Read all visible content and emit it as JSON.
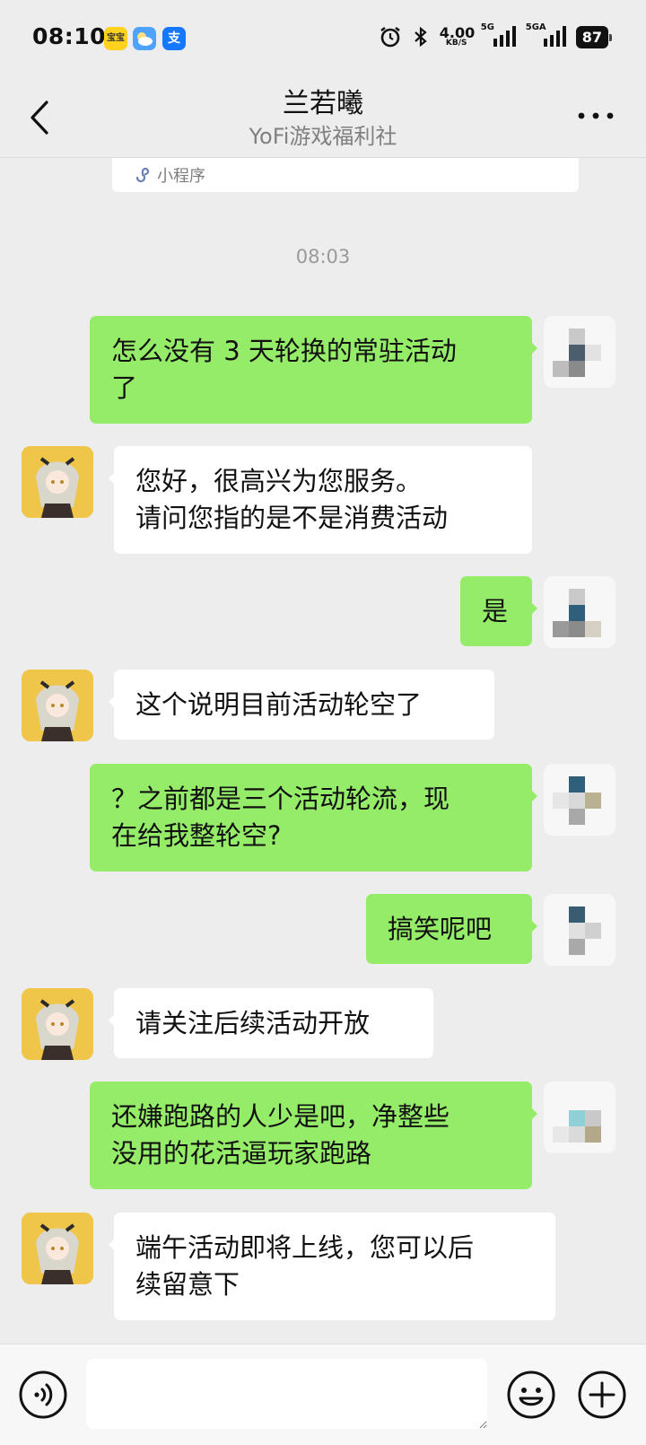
{
  "status_bar": {
    "time": "08:10",
    "app_icons": [
      {
        "icon": "baby-app-icon",
        "label": "宝宝"
      },
      {
        "icon": "weather-icon",
        "label": ""
      },
      {
        "icon": "alipay-icon",
        "label": "支"
      }
    ],
    "net_speed_value": "4.00",
    "net_speed_unit": "KB/S",
    "signal_1": "5G",
    "signal_2": "5GA",
    "battery": "87"
  },
  "header": {
    "title": "兰若曦",
    "subtitle": "YoFi游戏福利社",
    "back_icon": "chevron-left-icon",
    "more_icon": "more-dots-icon"
  },
  "mini_program": {
    "label": "小程序",
    "icon": "mini-program-icon"
  },
  "timestamp": "08:03",
  "messages": [
    {
      "from": "me",
      "text": "怎么没有 3 天轮换的常驻活动\n了"
    },
    {
      "from": "bot",
      "text": "您好，很高兴为您服务。\n请问您指的是不是消费活动"
    },
    {
      "from": "me",
      "text": "是"
    },
    {
      "from": "bot",
      "text": "这个说明目前活动轮空了"
    },
    {
      "from": "me",
      "text": "？之前都是三个活动轮流，现\n在给我整轮空?"
    },
    {
      "from": "me",
      "text": "搞笑呢吧"
    },
    {
      "from": "bot",
      "text": "请关注后续活动开放"
    },
    {
      "from": "me",
      "text": "还嫌跑路的人少是吧，净整些\n没用的花活逼玩家跑路"
    },
    {
      "from": "bot",
      "text": "端午活动即将上线，您可以后\n续留意下"
    }
  ],
  "input_bar": {
    "voice_icon": "voice-icon",
    "emoji_icon": "emoji-icon",
    "plus_icon": "plus-icon",
    "text_value": ""
  },
  "colors": {
    "background": "#ededed",
    "outgoing_bubble": "#95ec69",
    "incoming_bubble": "#ffffff",
    "subtitle": "#808080"
  }
}
